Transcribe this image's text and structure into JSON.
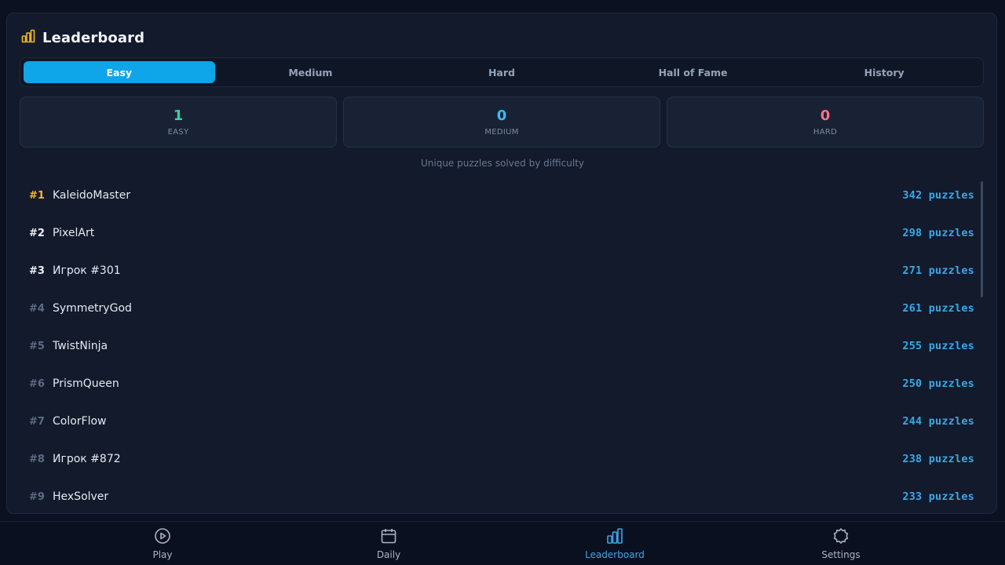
{
  "header": {
    "title": "Leaderboard",
    "icon": "bar-chart-icon",
    "accent": "#f5b921"
  },
  "tabs": [
    {
      "label": "Easy",
      "active": true
    },
    {
      "label": "Medium",
      "active": false
    },
    {
      "label": "Hard",
      "active": false
    },
    {
      "label": "Hall of Fame",
      "active": false
    },
    {
      "label": "History",
      "active": false
    }
  ],
  "stats": [
    {
      "value": "1",
      "label": "EASY",
      "color": "#34d399"
    },
    {
      "value": "0",
      "label": "MEDIUM",
      "color": "#38bdf8"
    },
    {
      "value": "0",
      "label": "HARD",
      "color": "#fb7185"
    }
  ],
  "caption": "Unique puzzles solved by difficulty",
  "leaderboard": [
    {
      "rank": "#1",
      "name": "KaleidoMaster",
      "score": "342 puzzles"
    },
    {
      "rank": "#2",
      "name": "PixelArt",
      "score": "298 puzzles"
    },
    {
      "rank": "#3",
      "name": "Игрок #301",
      "score": "271 puzzles"
    },
    {
      "rank": "#4",
      "name": "SymmetryGod",
      "score": "261 puzzles"
    },
    {
      "rank": "#5",
      "name": "TwistNinja",
      "score": "255 puzzles"
    },
    {
      "rank": "#6",
      "name": "PrismQueen",
      "score": "250 puzzles"
    },
    {
      "rank": "#7",
      "name": "ColorFlow",
      "score": "244 puzzles"
    },
    {
      "rank": "#8",
      "name": "Игрок #872",
      "score": "238 puzzles"
    },
    {
      "rank": "#9",
      "name": "HexSolver",
      "score": "233 puzzles"
    }
  ],
  "nav": [
    {
      "label": "Play",
      "icon": "play-circle-icon",
      "active": false
    },
    {
      "label": "Daily",
      "icon": "calendar-icon",
      "active": false
    },
    {
      "label": "Leaderboard",
      "icon": "bar-chart-icon",
      "active": true
    },
    {
      "label": "Settings",
      "icon": "gear-icon",
      "active": false
    }
  ],
  "colors": {
    "accent": "#0ea5e9",
    "score": "#38a9e8",
    "background": "#0b1120"
  }
}
